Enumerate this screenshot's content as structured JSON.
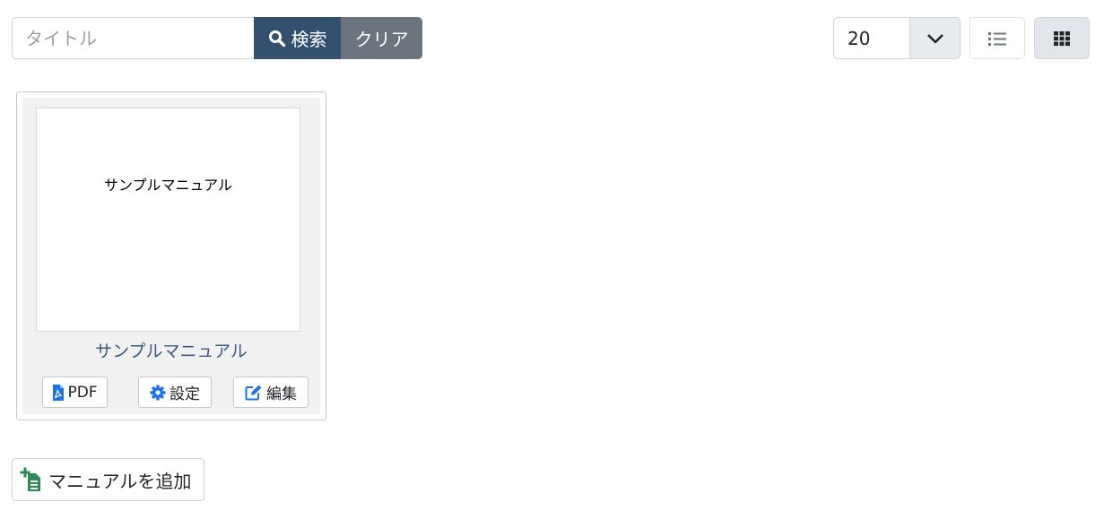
{
  "search": {
    "placeholder": "タイトル",
    "search_label": "検索",
    "clear_label": "クリア"
  },
  "pagination": {
    "per_page": "20"
  },
  "view_toggle": {
    "active": "grid"
  },
  "manuals": [
    {
      "thumbnail_text": "サンプルマニュアル",
      "title": "サンプルマニュアル",
      "pdf_label": "PDF",
      "settings_label": "設定",
      "edit_label": "編集"
    }
  ],
  "add_button": {
    "label": "マニュアルを追加"
  },
  "colors": {
    "search_button": "#33506f",
    "clear_button": "#6c757d",
    "title_link": "#3d5a80",
    "icon_blue": "#1a73e8",
    "add_icon_green": "#2e8b57"
  }
}
